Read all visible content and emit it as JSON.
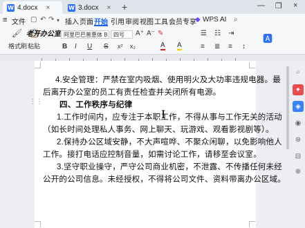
{
  "tabs": [
    {
      "label": "4.docx",
      "icon": "word-icon",
      "icon_letter": "W",
      "close": "×"
    },
    {
      "label": "3.docx",
      "icon": "word-icon",
      "icon_letter": "W",
      "close": "×"
    }
  ],
  "new_tab": "+",
  "window": {
    "minimize": "—",
    "maximize": "❐",
    "close": "×"
  },
  "menu": {
    "file_label": "文件",
    "items": [
      "插入",
      "页面",
      "引用",
      "审阅",
      "视图",
      "工具",
      "会员专享"
    ],
    "active": "开始",
    "ai_label": "WPS AI"
  },
  "ribbon": {
    "format_painter": "格式刷",
    "paste": "粘贴",
    "watermark_text": "老开办公室",
    "font_name": "阿里巴巴普惠体 B",
    "font_size": "四号",
    "bold": "B",
    "italic": "I",
    "underline": "U",
    "strike": "S",
    "font_color": "A",
    "highlight": "A"
  },
  "document": {
    "lines": [
      {
        "text": "4.安全管理：严禁在室内吸烟、使用明火及大功率违规电器。最",
        "bold": false
      },
      {
        "text": "后离开办公室的员工有责任检查并关闭所有电源。",
        "bold": false
      },
      {
        "text": "四、工作秩序与纪律",
        "bold": true
      },
      {
        "text": "1.工作时间内，应专注于本职工作，不得从事与工作无关的活动",
        "bold": false
      },
      {
        "text": "（如长时间处理私人事务、网上聊天、玩游戏、观看影视剧等）。",
        "bold": false
      },
      {
        "text": "2.保持办公区域安静，不大声喧哗、不聚众闲聊，以免影响他人",
        "bold": false
      },
      {
        "text": "工作。接打电话应控制音量，如需讨论工作，请移至会议室。",
        "bold": false
      },
      {
        "text": "3.坚守职业操守，严守公司商业机密，不泄露、不传播任何未经",
        "bold": false
      },
      {
        "text": "公开的公司信息。未经授权，不得将公司文件、资料带离办公区域。",
        "bold": false
      }
    ]
  }
}
